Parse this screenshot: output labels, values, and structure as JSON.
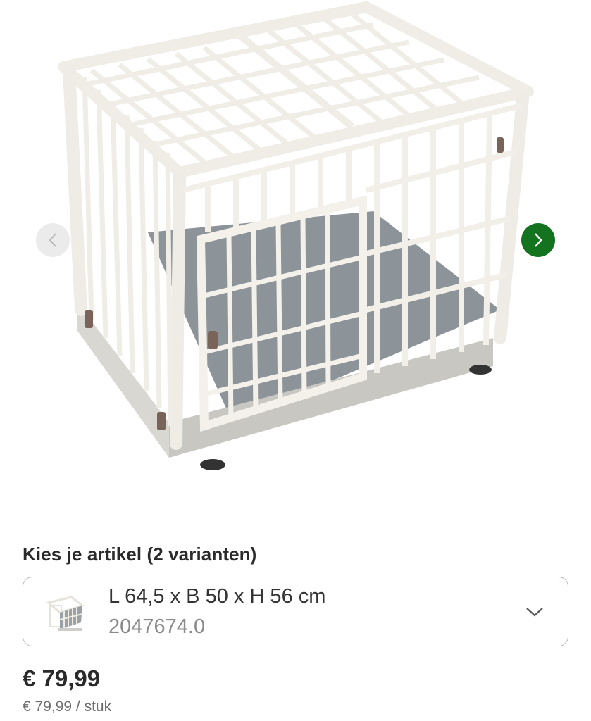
{
  "gallery": {
    "image_icon": "dog-crate-image",
    "prev_icon": "chevron-left-icon",
    "next_icon": "chevron-right-icon",
    "next_color": "#13731f",
    "prev_color": "#ecebeb"
  },
  "variants": {
    "heading": "Kies je artikel (2 varianten)",
    "selected": {
      "name": "L 64,5 x B 50 x H 56 cm",
      "code": "2047674.0",
      "thumb_icon": "dog-crate-thumbnail"
    },
    "dropdown_icon": "chevron-down-icon"
  },
  "pricing": {
    "price": "€ 79,99",
    "unit_price": "€ 79,99 / stuk"
  }
}
